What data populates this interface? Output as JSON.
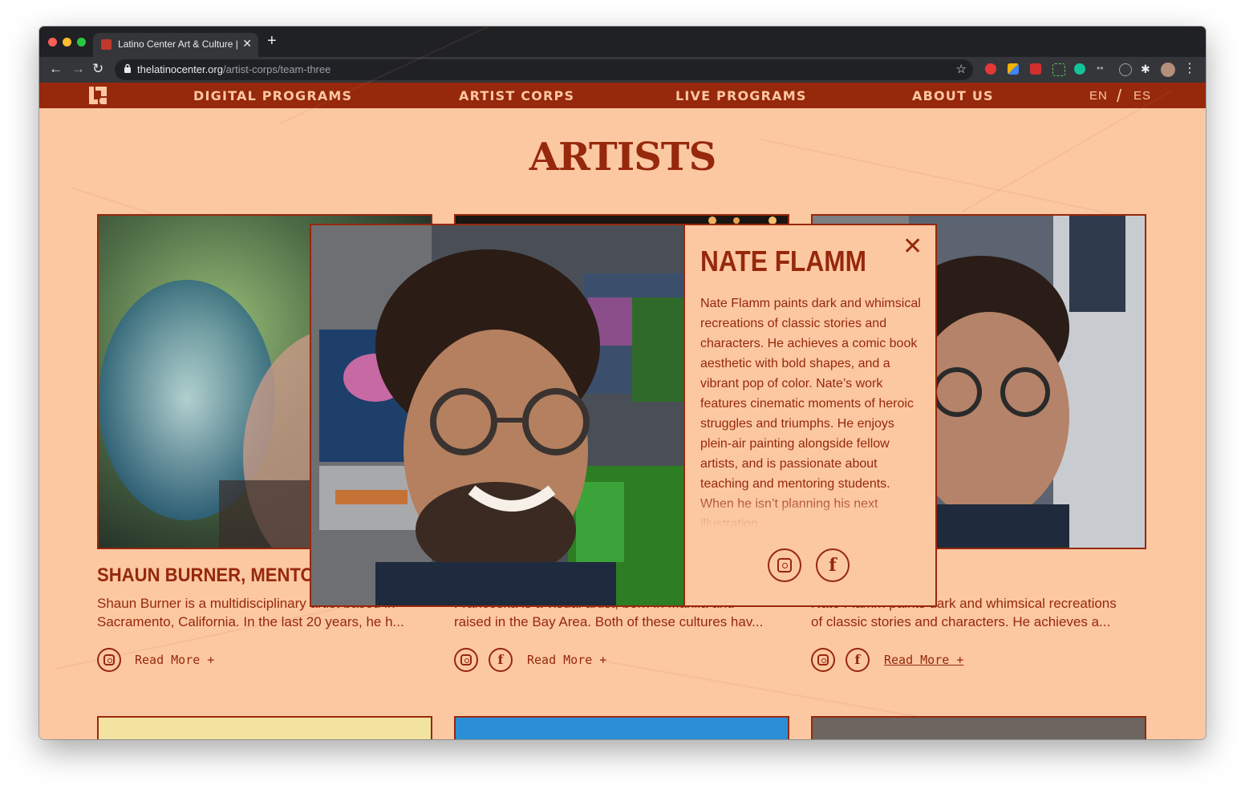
{
  "browser": {
    "tab_title": "Latino Center Art & Culture | V",
    "url_host": "thelatinocenter.org",
    "url_path": "/artist-corps/team-three"
  },
  "nav": {
    "items": [
      "DIGITAL PROGRAMS",
      "ARTIST CORPS",
      "LIVE PROGRAMS",
      "ABOUT US"
    ],
    "lang_en": "EN",
    "lang_sep": "/",
    "lang_es": "ES"
  },
  "page": {
    "title": "ARTISTS"
  },
  "cards": [
    {
      "name": "SHAUN BURNER, MENTOR",
      "desc_line1": "Shaun Burner is a multidisciplinary artist based in",
      "desc_line2": "Sacramento, California. In the last 20 years, he h...",
      "read_more": "Read More +"
    },
    {
      "name": "",
      "desc_line1": "Franceska is a visual artist, born in Manila and",
      "desc_line2": "raised in the Bay Area. Both of these cultures hav...",
      "read_more": "Read More +"
    },
    {
      "name": "",
      "desc_line1": "Nate Flamm paints dark and whimsical recreations",
      "desc_line2": "of classic stories and characters. He achieves a...",
      "read_more": "Read More +"
    }
  ],
  "modal": {
    "name": "NATE FLAMM",
    "close": "✕",
    "bio": "Nate Flamm paints dark and whimsical recreations of classic stories and characters. He achieves a comic book aesthetic with bold shapes, and a vibrant pop of color. Nate’s work features cinematic moments of heroic struggles and triumphs. He enjoys plein-air painting alongside fellow artists, and is passionate about teaching and mentoring students. When he isn’t planning his next illustration,"
  },
  "colors": {
    "brand": "#96280c",
    "page_bg": "#fcc8a2"
  },
  "icons": [
    "instagram-icon",
    "facebook-icon",
    "close-icon",
    "lock-icon",
    "star-icon"
  ]
}
